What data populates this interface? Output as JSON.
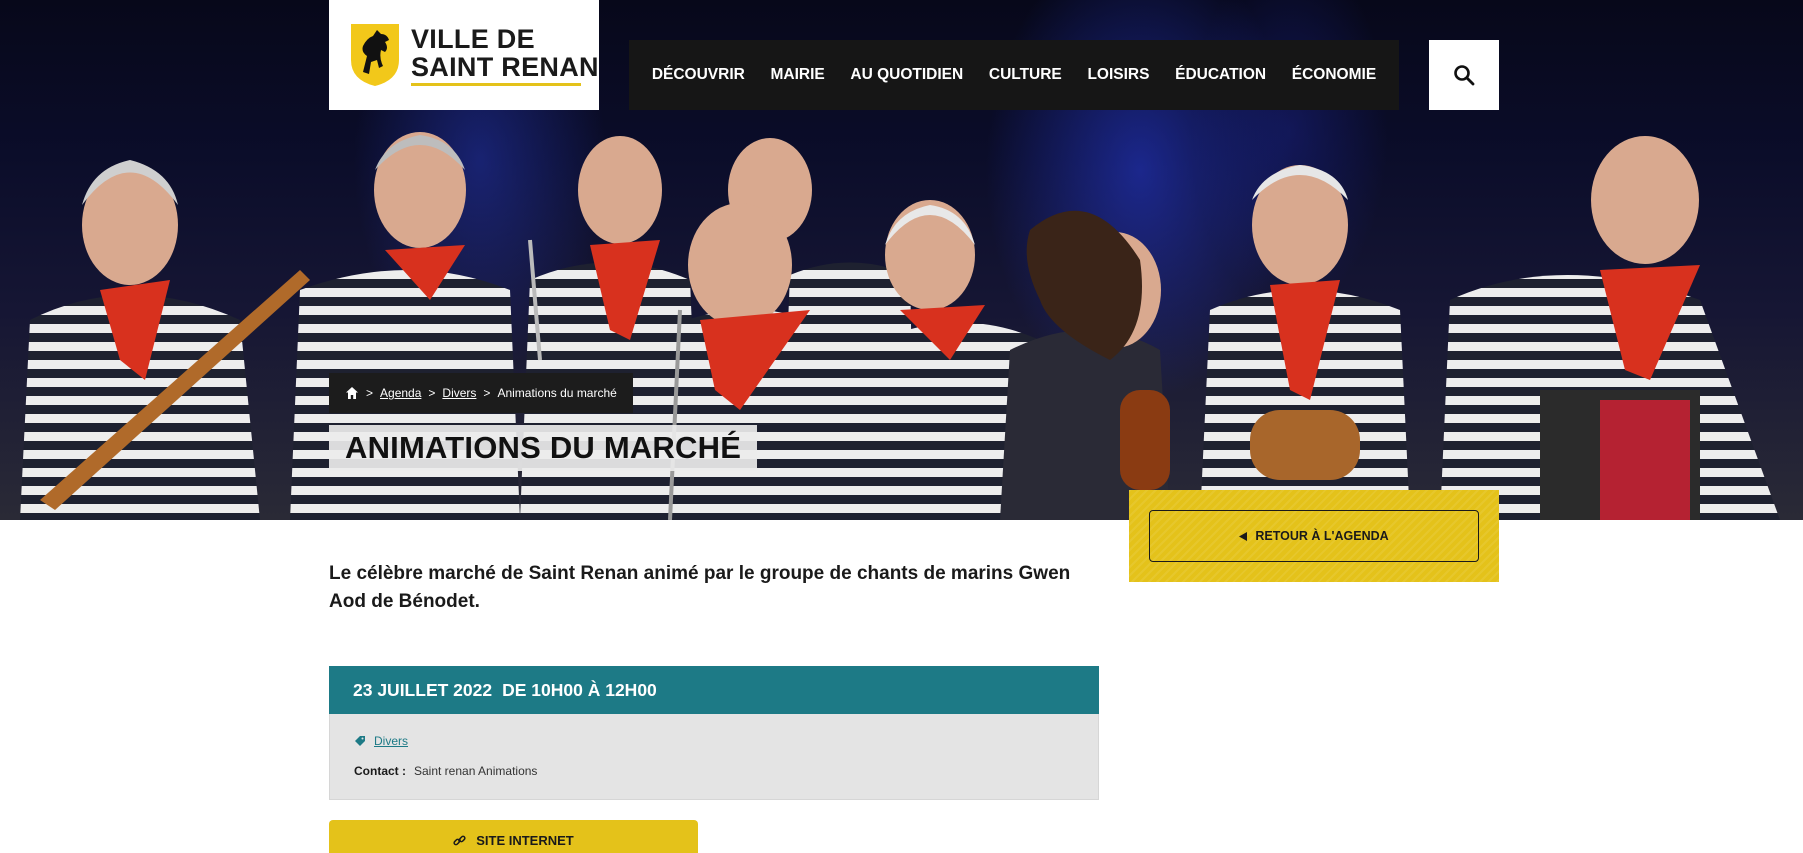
{
  "brand": {
    "line1": "VILLE DE",
    "line2": "SAINT RENAN",
    "accent_color": "#e4c21a"
  },
  "nav": {
    "items": [
      {
        "label": "DÉCOUVRIR"
      },
      {
        "label": "MAIRIE"
      },
      {
        "label": "AU QUOTIDIEN"
      },
      {
        "label": "CULTURE"
      },
      {
        "label": "LOISIRS"
      },
      {
        "label": "ÉDUCATION"
      },
      {
        "label": "ÉCONOMIE"
      }
    ],
    "search_icon": "search-icon"
  },
  "breadcrumb": {
    "home_icon": "home-icon",
    "separator": ">",
    "items": [
      {
        "label": "Agenda"
      },
      {
        "label": "Divers"
      }
    ],
    "current": "Animations du marché"
  },
  "page": {
    "title": "ANIMATIONS DU MARCHÉ",
    "intro": "Le célèbre marché de Saint Renan animé par le groupe de chants de marins Gwen Aod de Bénodet."
  },
  "retour": {
    "label": "RETOUR À L'AGENDA",
    "icon": "triangle-left-icon"
  },
  "event": {
    "date": "23 JUILLET 2022",
    "time": "DE 10H00 À 12H00",
    "bar_color": "#1d7a86",
    "category_icon": "tag-icon",
    "category": "Divers",
    "contact_label": "Contact :",
    "contact_value": "Saint renan Animations"
  },
  "site_button": {
    "label": "SITE INTERNET",
    "icon": "link-icon"
  }
}
